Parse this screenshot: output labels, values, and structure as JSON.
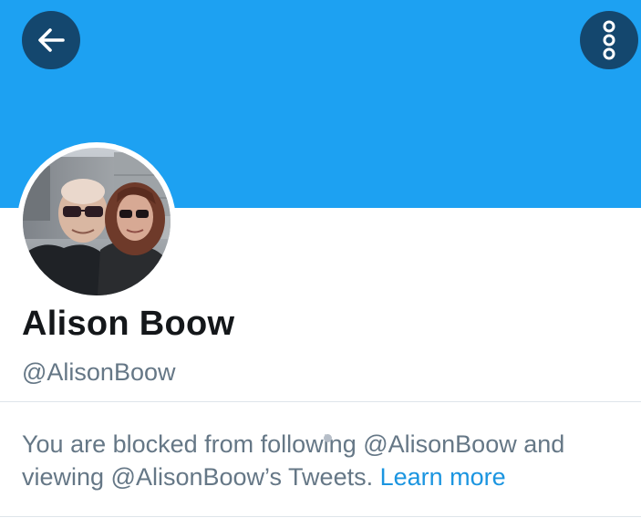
{
  "profile": {
    "name": "Alison Boow",
    "handle": "@AlisonBoow",
    "banner_color": "#1da1f2"
  },
  "header": {
    "back_icon": "arrow-left-icon",
    "more_icon": "more-vertical-icon",
    "button_color": "#14476e"
  },
  "blocked_notice": {
    "line1": "You are blocked from following @AlisonBoow and viewing @AlisonBoow’s Tweets.",
    "link_text": "Learn more",
    "link_color": "#1b95e0"
  }
}
